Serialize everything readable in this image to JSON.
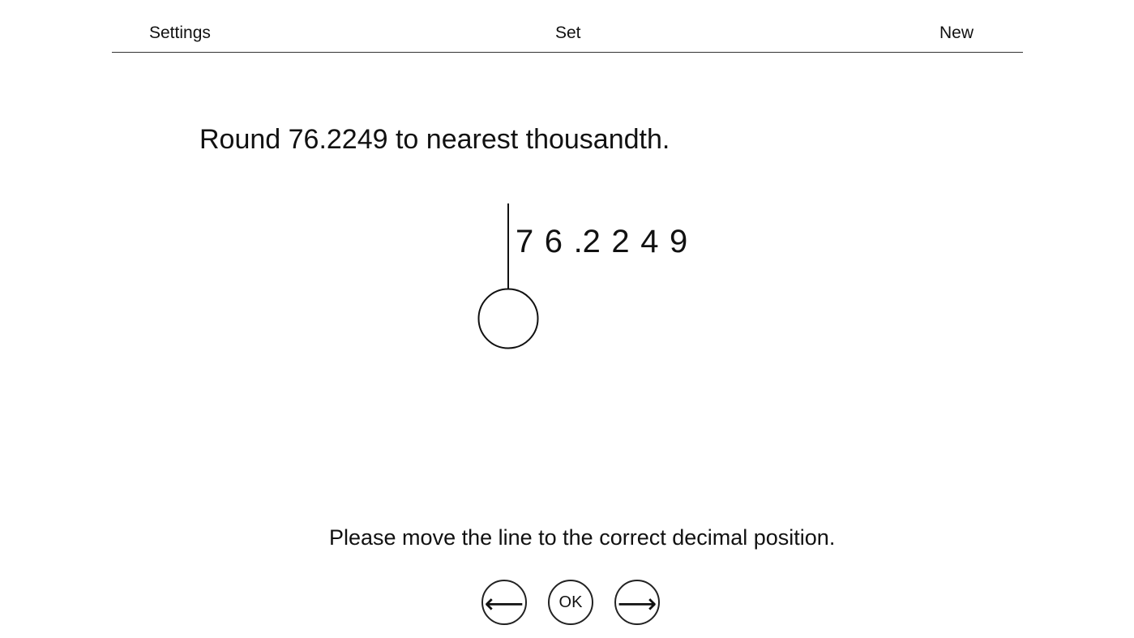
{
  "menu": {
    "settings_label": "Settings",
    "set_label": "Set",
    "new_label": "New"
  },
  "question": {
    "text": "Round 76.2249 to nearest thousandth."
  },
  "number_display": {
    "digits": [
      "7",
      "6",
      ".",
      "2",
      "2",
      "4",
      "9"
    ]
  },
  "instruction": {
    "text": "Please move the line to the correct decimal position."
  },
  "controls": {
    "left_icon": "left-arrow-icon",
    "left_glyph": "⟵",
    "ok_label": "OK",
    "right_icon": "right-arrow-icon",
    "right_glyph": "⟶"
  }
}
